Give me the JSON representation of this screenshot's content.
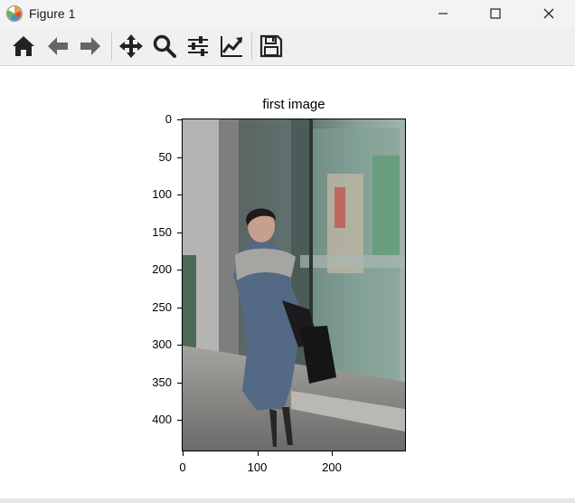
{
  "window": {
    "title": "Figure 1",
    "controls": {
      "minimize": "minimize",
      "maximize": "maximize",
      "close": "close"
    }
  },
  "toolbar": {
    "buttons": [
      {
        "name": "home",
        "icon": "home-icon"
      },
      {
        "name": "back",
        "icon": "arrow-left-icon"
      },
      {
        "name": "forward",
        "icon": "arrow-right-icon"
      },
      {
        "name": "pan",
        "icon": "move-icon"
      },
      {
        "name": "zoom",
        "icon": "magnifier-icon"
      },
      {
        "name": "configure-subplots",
        "icon": "sliders-icon"
      },
      {
        "name": "edit-axis",
        "icon": "line-chart-icon"
      },
      {
        "name": "save",
        "icon": "floppy-disk-icon"
      }
    ]
  },
  "axes": {
    "title": "first image",
    "yticks": [
      "0",
      "50",
      "100",
      "150",
      "200",
      "250",
      "300",
      "350",
      "400"
    ],
    "xticks": [
      "0",
      "100",
      "200"
    ]
  },
  "colors": {
    "titlebar_bg": "#f3f3f3",
    "toolbar_bg": "#f0f0f0",
    "icon_dark": "#222222",
    "icon_gray": "#666666"
  }
}
